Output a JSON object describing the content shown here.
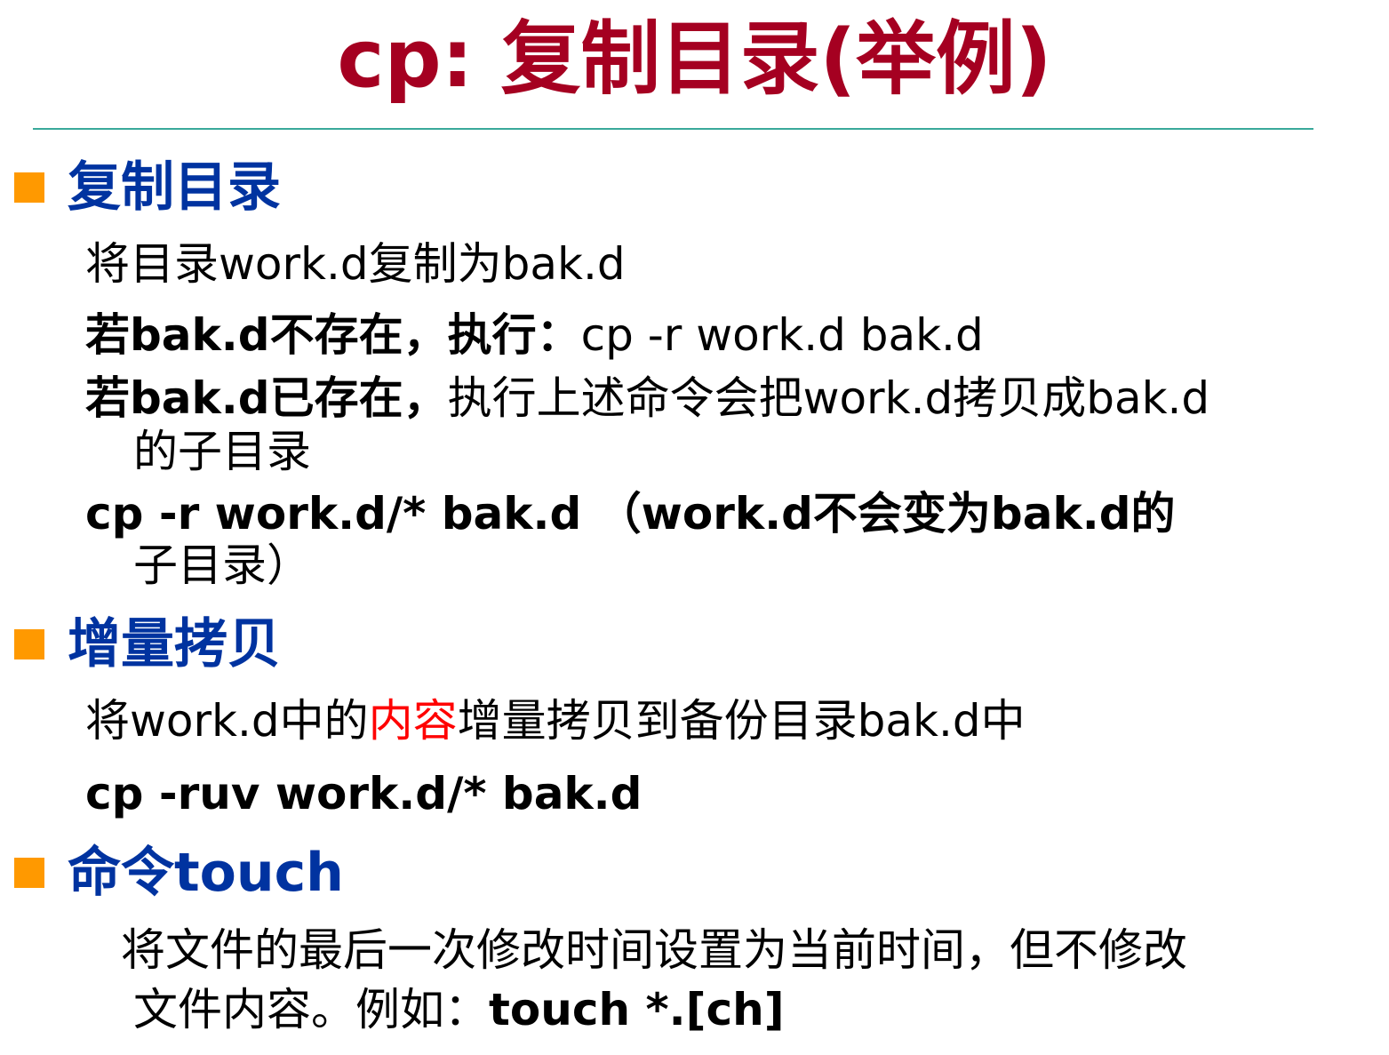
{
  "title": "cp: 复制目录(举例)",
  "sections": [
    {
      "heading": "复制目录",
      "lines": [
        {
          "text": "将目录work.d复制为bak.d"
        },
        {
          "bold": "若bak.d不存在，执行：",
          "normal": "cp -r work.d  bak.d"
        },
        {
          "bold": "若bak.d已存在，",
          "normal": "执行上述命令会把work.d拷贝成bak.d",
          "cont": "的子目录"
        },
        {
          "bold": "cp -r work.d/*  bak.d （work.d不会变为bak.d的",
          "cont": "子目录）"
        }
      ]
    },
    {
      "heading": "增量拷贝",
      "lines": [
        {
          "before": "将work.d中的",
          "highlight": "内容",
          "after": "增量拷贝到备份目录bak.d中"
        },
        {
          "bold": "cp -ruv work.d/* bak.d"
        }
      ]
    },
    {
      "heading": "命令touch",
      "lines": [
        {
          "text": "将文件的最后一次修改时间设置为当前时间，但不修改",
          "cont_normal": "文件内容。例如：",
          "cont_bold": "touch *.[ch]"
        }
      ]
    }
  ],
  "colors": {
    "title": "#a50021",
    "heading": "#0033a0",
    "bullet": "#ff9900",
    "rule": "#3aa99a",
    "highlight": "#ff0000"
  }
}
